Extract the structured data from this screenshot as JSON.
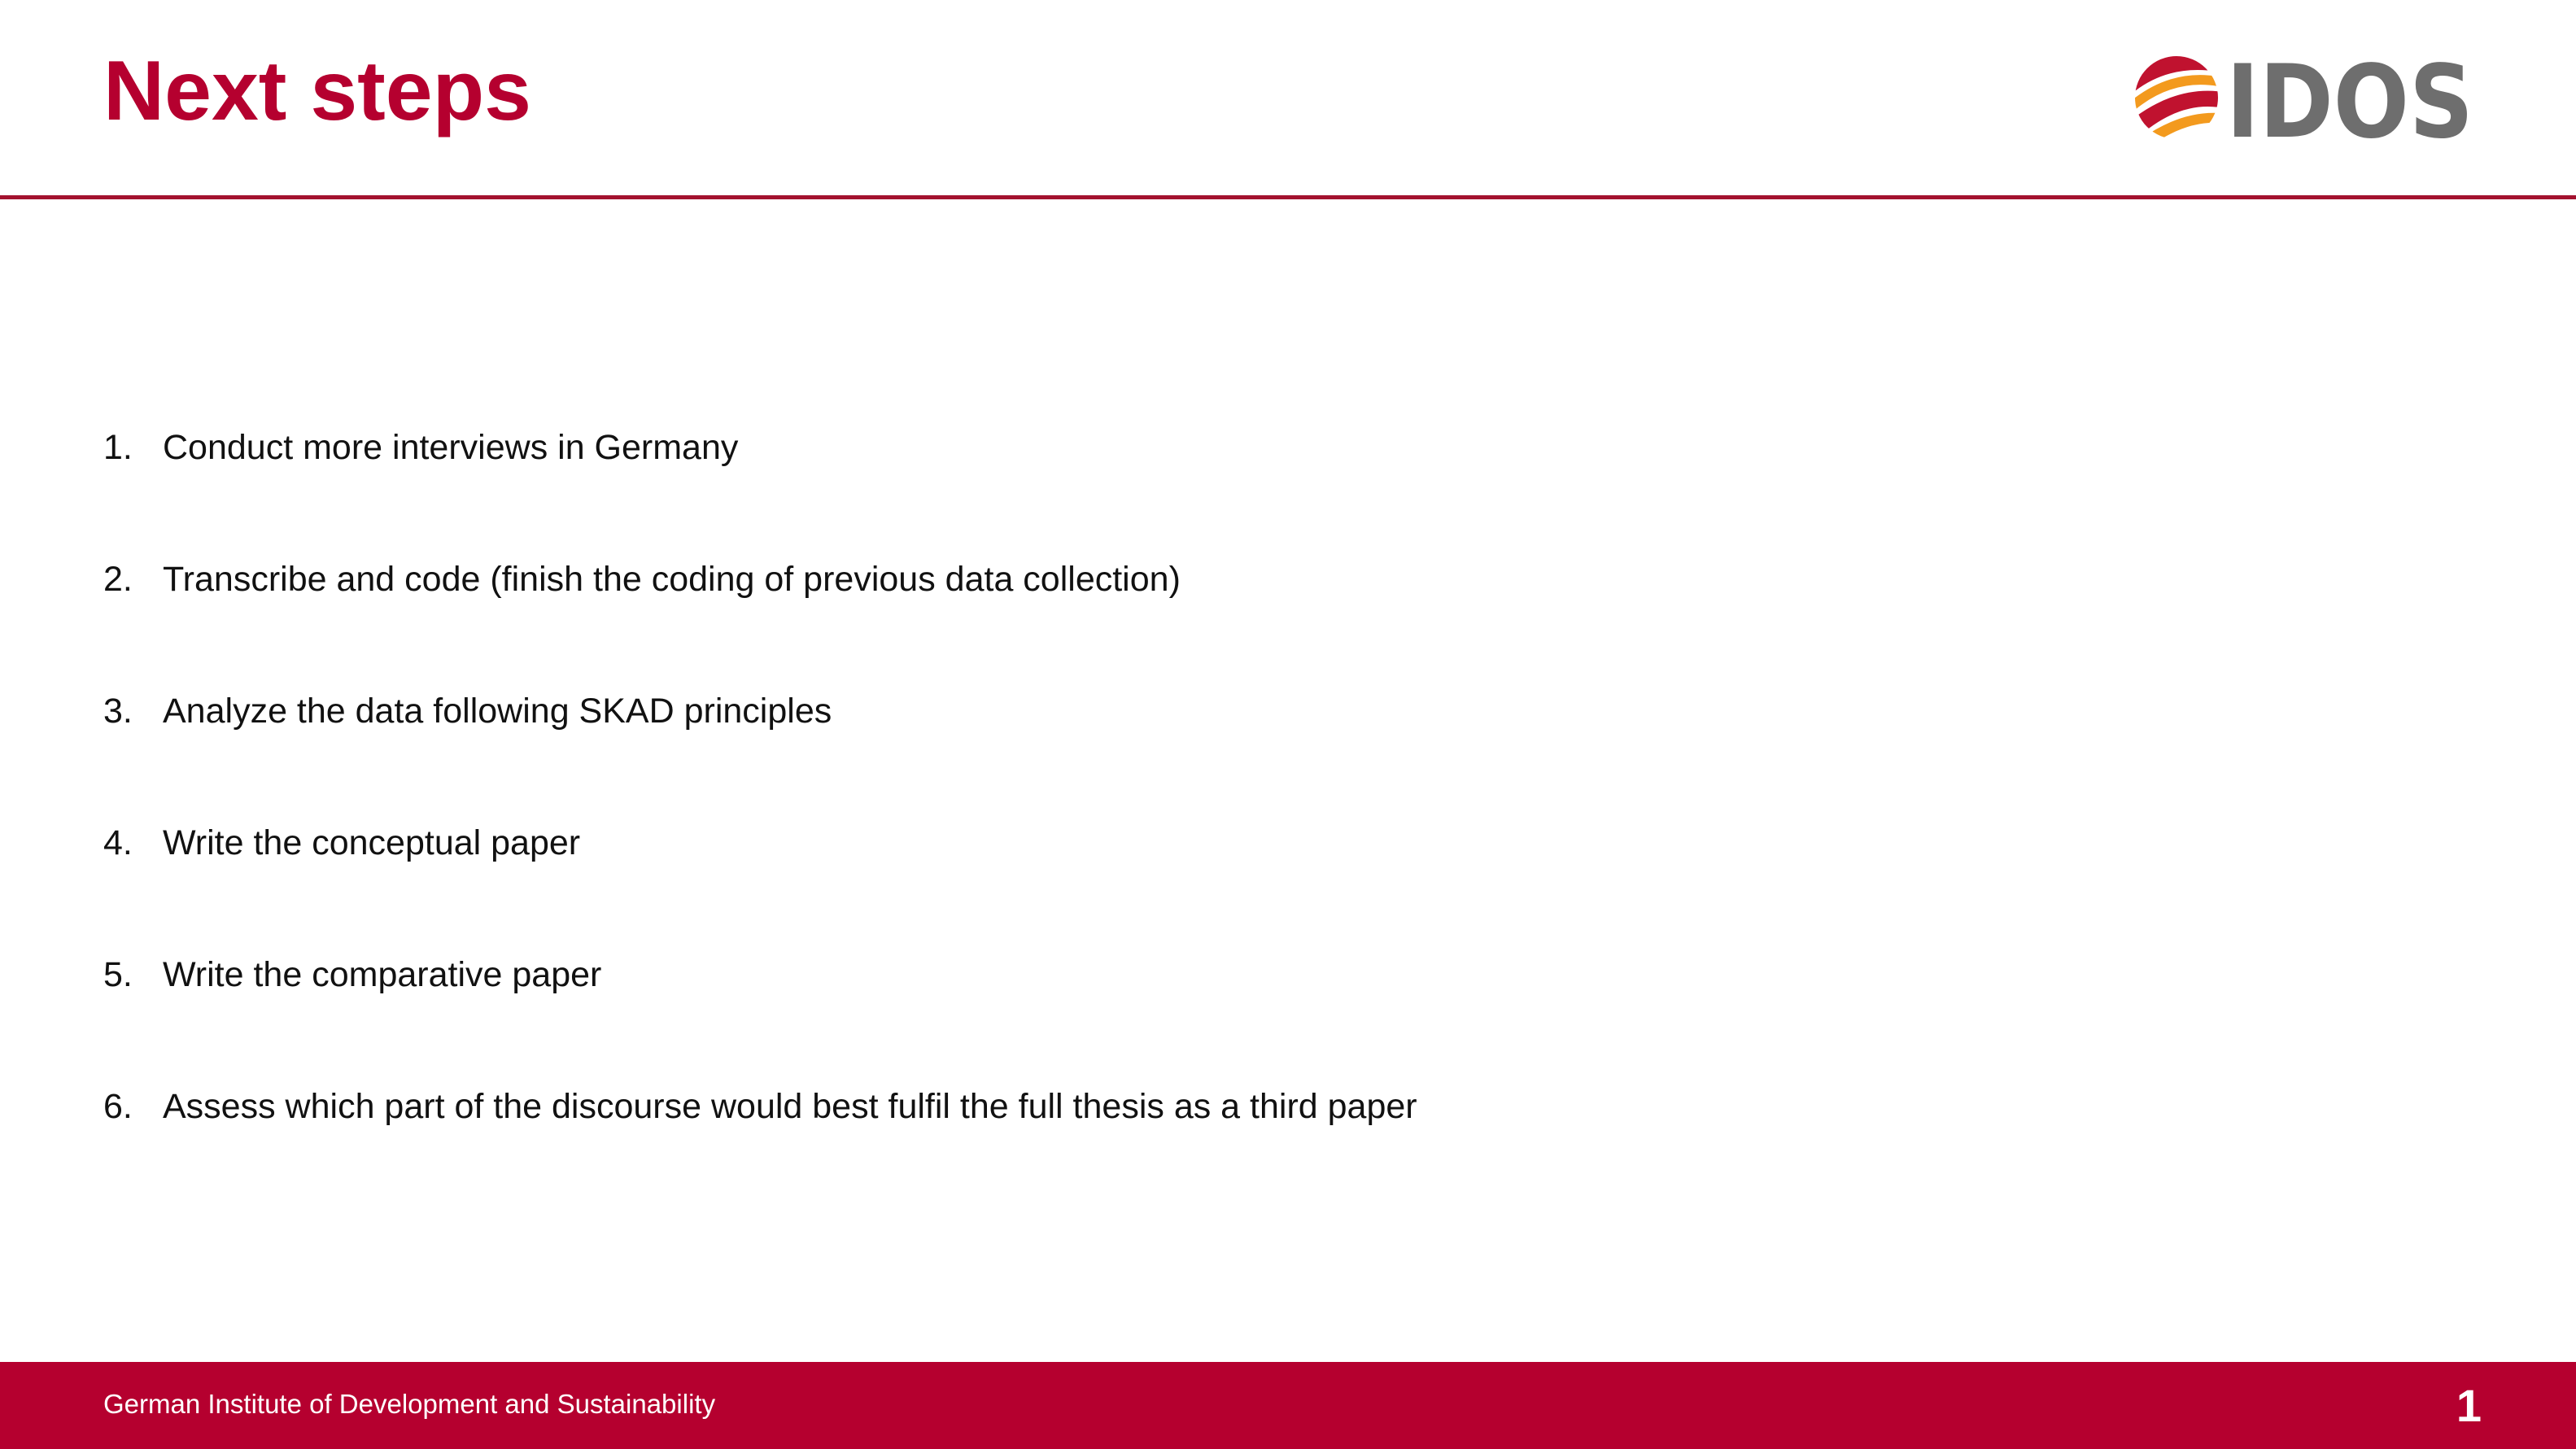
{
  "slide": {
    "title": "Next steps",
    "logo": {
      "icon": "globe-ribbon-icon",
      "text": "IDOS",
      "colors": {
        "red": "#c0122f",
        "orange": "#f39a1e",
        "grey": "#6e6e6e"
      }
    },
    "steps": [
      {
        "number": "1.",
        "text": "Conduct more interviews in Germany"
      },
      {
        "number": "2.",
        "text": "Transcribe and code (finish the coding of previous data collection)"
      },
      {
        "number": "3.",
        "text": "Analyze the data following SKAD principles"
      },
      {
        "number": "4.",
        "text": "Write the conceptual paper"
      },
      {
        "number": "5.",
        "text": "Write the comparative paper"
      },
      {
        "number": "6.",
        "text": "Assess which part of the discourse would best fulfil the full thesis as a third paper"
      }
    ]
  },
  "footer": {
    "organization": "German Institute of Development and Sustainability",
    "page_number": "1"
  },
  "colors": {
    "accent": "#b5002f",
    "rule": "#a3122f",
    "text": "#111111",
    "background": "#ffffff"
  }
}
